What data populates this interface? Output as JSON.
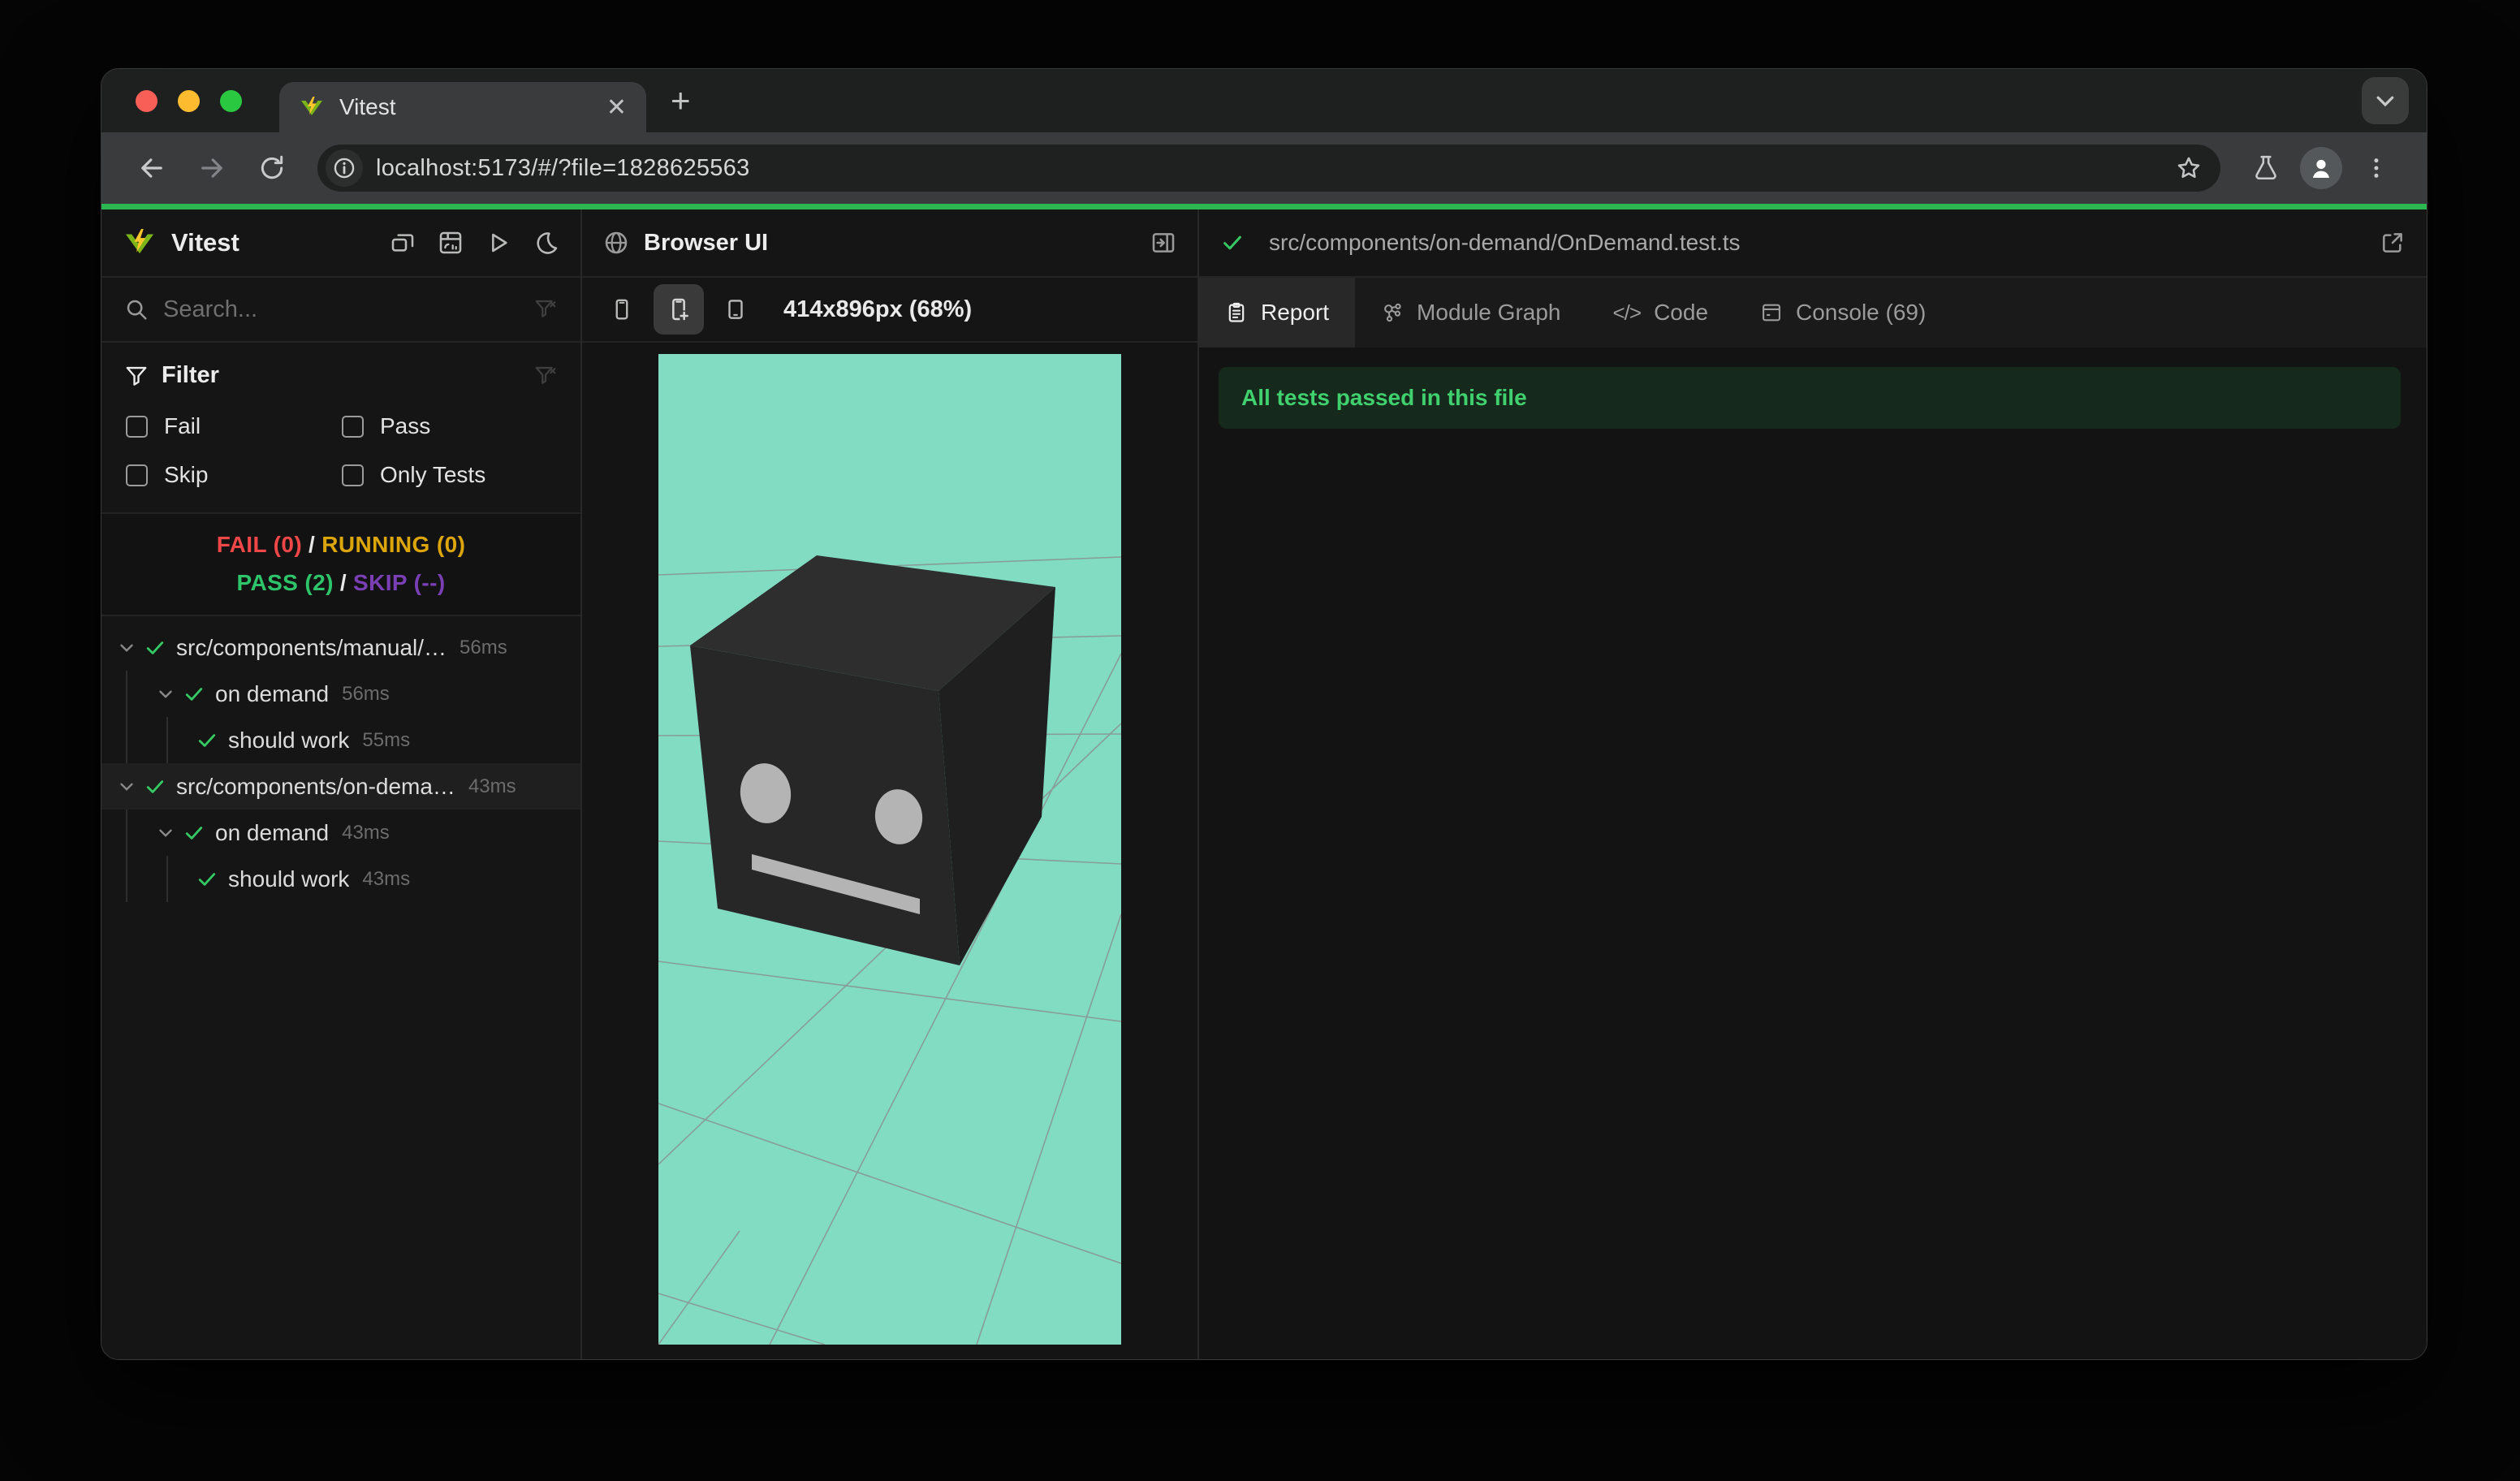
{
  "browser": {
    "tab_title": "Vitest",
    "url": "localhost:5173/#/?file=1828625563",
    "close_glyph": "✕",
    "new_tab_glyph": "+"
  },
  "sidebar": {
    "app_name": "Vitest",
    "search_placeholder": "Search...",
    "filter": {
      "title": "Filter",
      "options": [
        {
          "label": "Fail",
          "checked": false
        },
        {
          "label": "Pass",
          "checked": false
        },
        {
          "label": "Skip",
          "checked": false
        },
        {
          "label": "Only Tests",
          "checked": false
        }
      ]
    },
    "summary": {
      "fail": "FAIL (0)",
      "running": "RUNNING (0)",
      "pass": "PASS (2)",
      "skip": "SKIP (--)",
      "separator": "/"
    },
    "tree": [
      {
        "level": 0,
        "label": "src/components/manual/…",
        "duration": "56ms",
        "selected": false
      },
      {
        "level": 1,
        "label": "on demand",
        "duration": "56ms",
        "selected": false
      },
      {
        "level": 2,
        "label": "should work",
        "duration": "55ms",
        "selected": false
      },
      {
        "level": 0,
        "label": "src/components/on-dema…",
        "duration": "43ms",
        "selected": true
      },
      {
        "level": 1,
        "label": "on demand",
        "duration": "43ms",
        "selected": false
      },
      {
        "level": 2,
        "label": "should work",
        "duration": "43ms",
        "selected": false
      }
    ]
  },
  "mid": {
    "title": "Browser UI",
    "size_label": "414x896px (68%)"
  },
  "right": {
    "file_path": "src/components/on-demand/OnDemand.test.ts",
    "tabs": [
      {
        "label": "Report",
        "active": true
      },
      {
        "label": "Module Graph",
        "active": false
      },
      {
        "label": "Code",
        "active": false
      },
      {
        "label": "Console (69)",
        "active": false
      }
    ],
    "banner": "All tests passed in this file"
  },
  "colors": {
    "progress_green": "#2bb751",
    "check_green": "#35c963",
    "fail_red": "#ef4747",
    "running_amber": "#dca50a",
    "pass_green": "#2ec46a",
    "skip_purple": "#7a3fb5",
    "banner_bg": "#152a1c",
    "banner_text": "#40d16e",
    "preview_background": "#81dcc2",
    "cube_top": "#2e2e2e",
    "cube_front": "#272728",
    "cube_right": "#1f1f20"
  },
  "scene": {
    "description": "3D robot-head cube on teal grid floor",
    "background": "#81dcc2"
  }
}
